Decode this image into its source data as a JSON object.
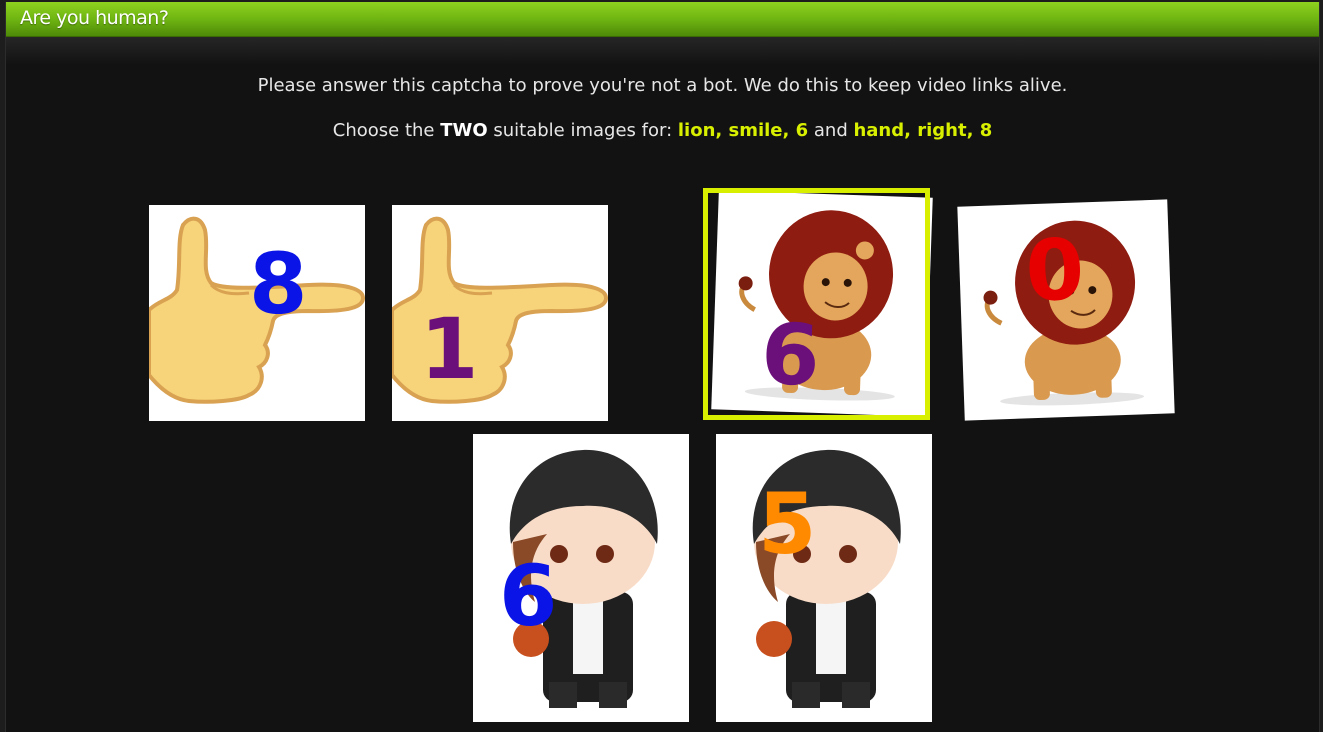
{
  "window": {
    "title": "Are you human?"
  },
  "captcha": {
    "intro": "Please answer this captcha to prove you're not a bot. We do this to keep video links alive.",
    "q_prefix": "Choose the ",
    "q_count": "TWO",
    "q_middle": " suitable images for: ",
    "set_a": "lion, smile, 6",
    "q_and": " and ",
    "set_b": "hand, right, 8",
    "tiles": [
      {
        "subject": "hand pointing right",
        "number": "8",
        "color": "#0a14e6",
        "selected": false
      },
      {
        "subject": "hand pointing right",
        "number": "1",
        "color": "#6b0f7a",
        "selected": false
      },
      {
        "subject": "smiling lion",
        "number": "6",
        "color": "#6b0f7a",
        "selected": true
      },
      {
        "subject": "smiling lion",
        "number": "0",
        "color": "#e60000",
        "selected": false
      },
      {
        "subject": "chibi boy with beanie",
        "number": "6",
        "color": "#0a14e6",
        "selected": false
      },
      {
        "subject": "chibi boy with beanie",
        "number": "5",
        "color": "#ff8a00",
        "selected": false
      }
    ],
    "selection_color": "#d8f000"
  },
  "colors": {
    "title_bar": "#6fb512",
    "background": "#121212",
    "highlight": "#d8f000"
  }
}
